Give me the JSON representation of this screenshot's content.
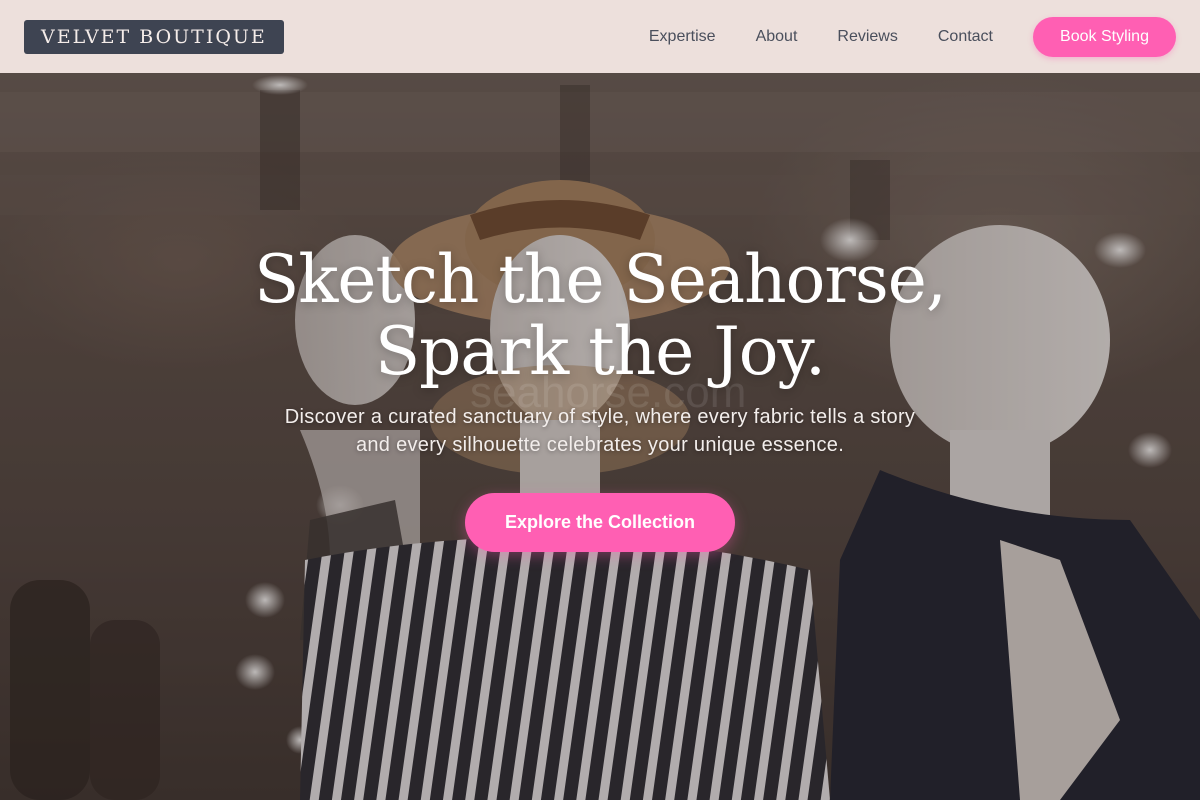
{
  "brand": {
    "logo_text": "VELVET BOUTIQUE"
  },
  "nav": {
    "links": [
      "Expertise",
      "About",
      "Reviews",
      "Contact"
    ],
    "cta_label": "Book Styling"
  },
  "hero": {
    "headline_line1": "Sketch the Seahorse,",
    "headline_line2": "Spark the Joy.",
    "subtext": "Discover a curated sanctuary of style, where every fabric tells a story and every silhouette celebrates your unique essence.",
    "cta_label": "Explore the Collection",
    "watermark": "seahorse.com",
    "background_image": "boutique-mannequins-photo"
  },
  "colors": {
    "accent": "#ff5fb3",
    "logo_bg": "#3e4452",
    "nav_bg": "#f6eae6",
    "nav_text": "#4a4f5c"
  }
}
